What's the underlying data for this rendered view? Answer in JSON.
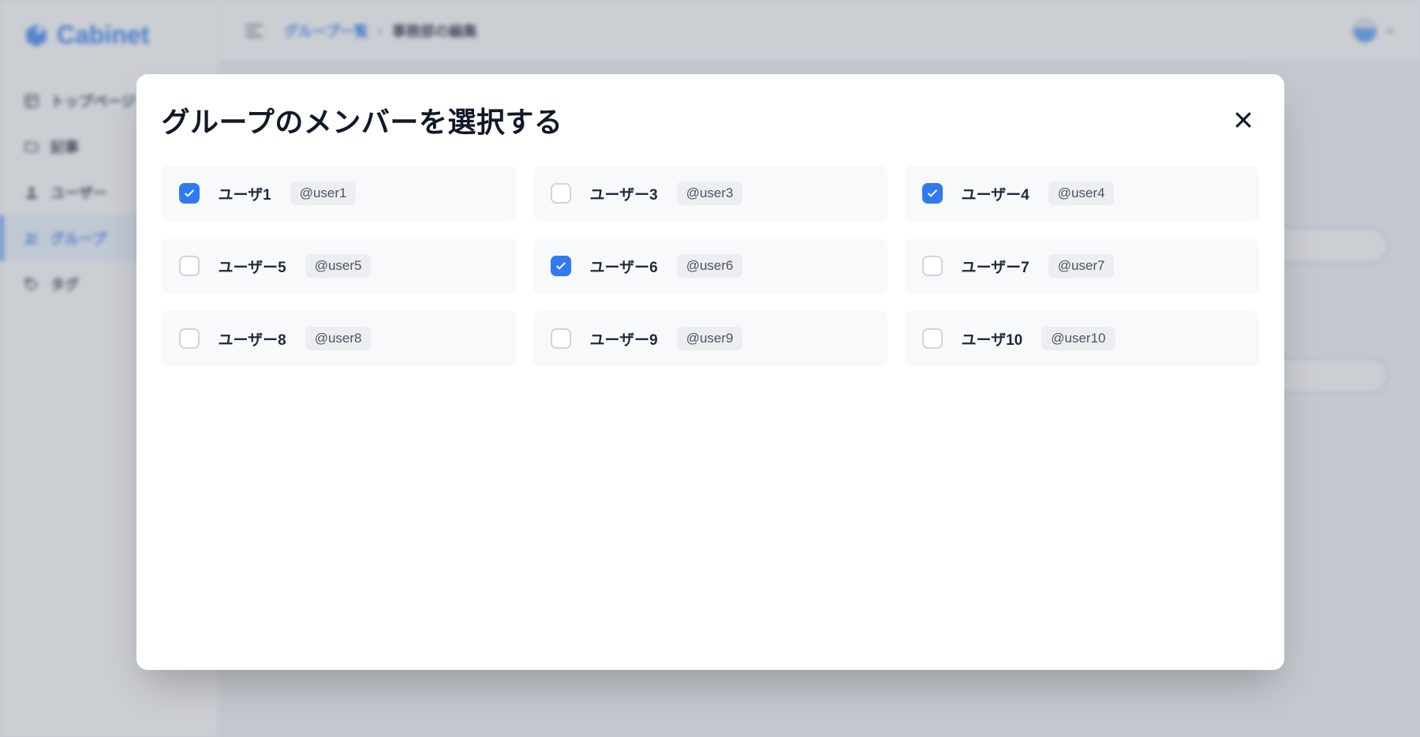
{
  "app": {
    "name": "Cabinet"
  },
  "sidebar": {
    "items": [
      {
        "label": "トップページ",
        "icon": "layout-icon",
        "active": false
      },
      {
        "label": "記事",
        "icon": "folder-icon",
        "active": false
      },
      {
        "label": "ユーザー",
        "icon": "user-icon",
        "active": false
      },
      {
        "label": "グループ",
        "icon": "users-icon",
        "active": true
      },
      {
        "label": "タグ",
        "icon": "tag-icon",
        "active": false
      }
    ]
  },
  "breadcrumb": {
    "parent": "グループ一覧",
    "separator": "›",
    "current": "事務部の編集"
  },
  "modal": {
    "title": "グループのメンバーを選択する",
    "members": [
      {
        "name": "ユーザ1",
        "handle": "@user1",
        "checked": true
      },
      {
        "name": "ユーザー3",
        "handle": "@user3",
        "checked": false
      },
      {
        "name": "ユーザー4",
        "handle": "@user4",
        "checked": true
      },
      {
        "name": "ユーザー5",
        "handle": "@user5",
        "checked": false
      },
      {
        "name": "ユーザー6",
        "handle": "@user6",
        "checked": true
      },
      {
        "name": "ユーザー7",
        "handle": "@user7",
        "checked": false
      },
      {
        "name": "ユーザー8",
        "handle": "@user8",
        "checked": false
      },
      {
        "name": "ユーザー9",
        "handle": "@user9",
        "checked": false
      },
      {
        "name": "ユーザ10",
        "handle": "@user10",
        "checked": false
      }
    ]
  }
}
